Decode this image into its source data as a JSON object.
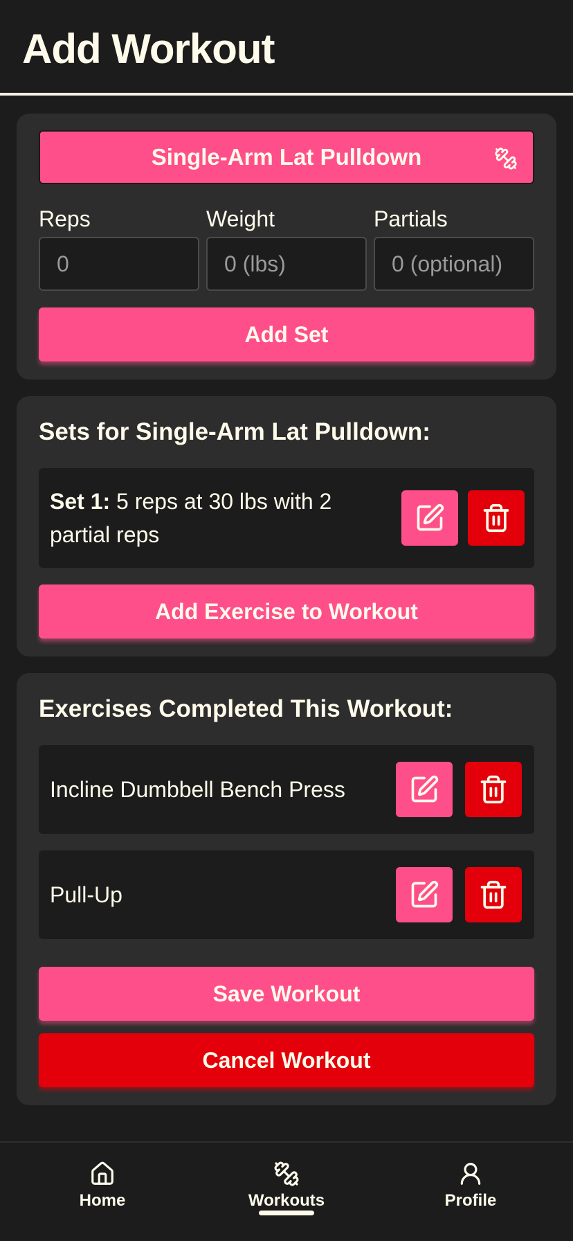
{
  "header": {
    "title": "Add Workout"
  },
  "exercise_picker": {
    "selected": "Single-Arm Lat Pulldown",
    "icon": "dumbbell-icon"
  },
  "fields": {
    "reps": {
      "label": "Reps",
      "placeholder": "0",
      "value": ""
    },
    "weight": {
      "label": "Weight",
      "placeholder": "0 (lbs)",
      "value": ""
    },
    "partials": {
      "label": "Partials",
      "placeholder": "0 (optional)",
      "value": ""
    }
  },
  "add_set_label": "Add Set",
  "sets_section": {
    "title": "Sets for Single-Arm Lat Pulldown:",
    "sets": [
      {
        "prefix": "Set 1:",
        "text": " 5 reps at 30 lbs with 2 partial reps"
      }
    ],
    "add_exercise_label": "Add Exercise to Workout"
  },
  "completed_section": {
    "title": "Exercises Completed This Workout:",
    "exercises": [
      {
        "name": "Incline Dumbbell Bench Press"
      },
      {
        "name": "Pull-Up"
      }
    ],
    "save_label": "Save Workout",
    "cancel_label": "Cancel Workout"
  },
  "nav": {
    "items": [
      {
        "label": "Home",
        "icon": "home-icon"
      },
      {
        "label": "Workouts",
        "icon": "dumbbell-icon",
        "active": true
      },
      {
        "label": "Profile",
        "icon": "user-icon"
      }
    ]
  },
  "colors": {
    "background": "#1c1c1c",
    "card": "#2d2d2d",
    "accent": "#ff4f8b",
    "danger": "#e3000b",
    "text": "#fffbeb"
  }
}
